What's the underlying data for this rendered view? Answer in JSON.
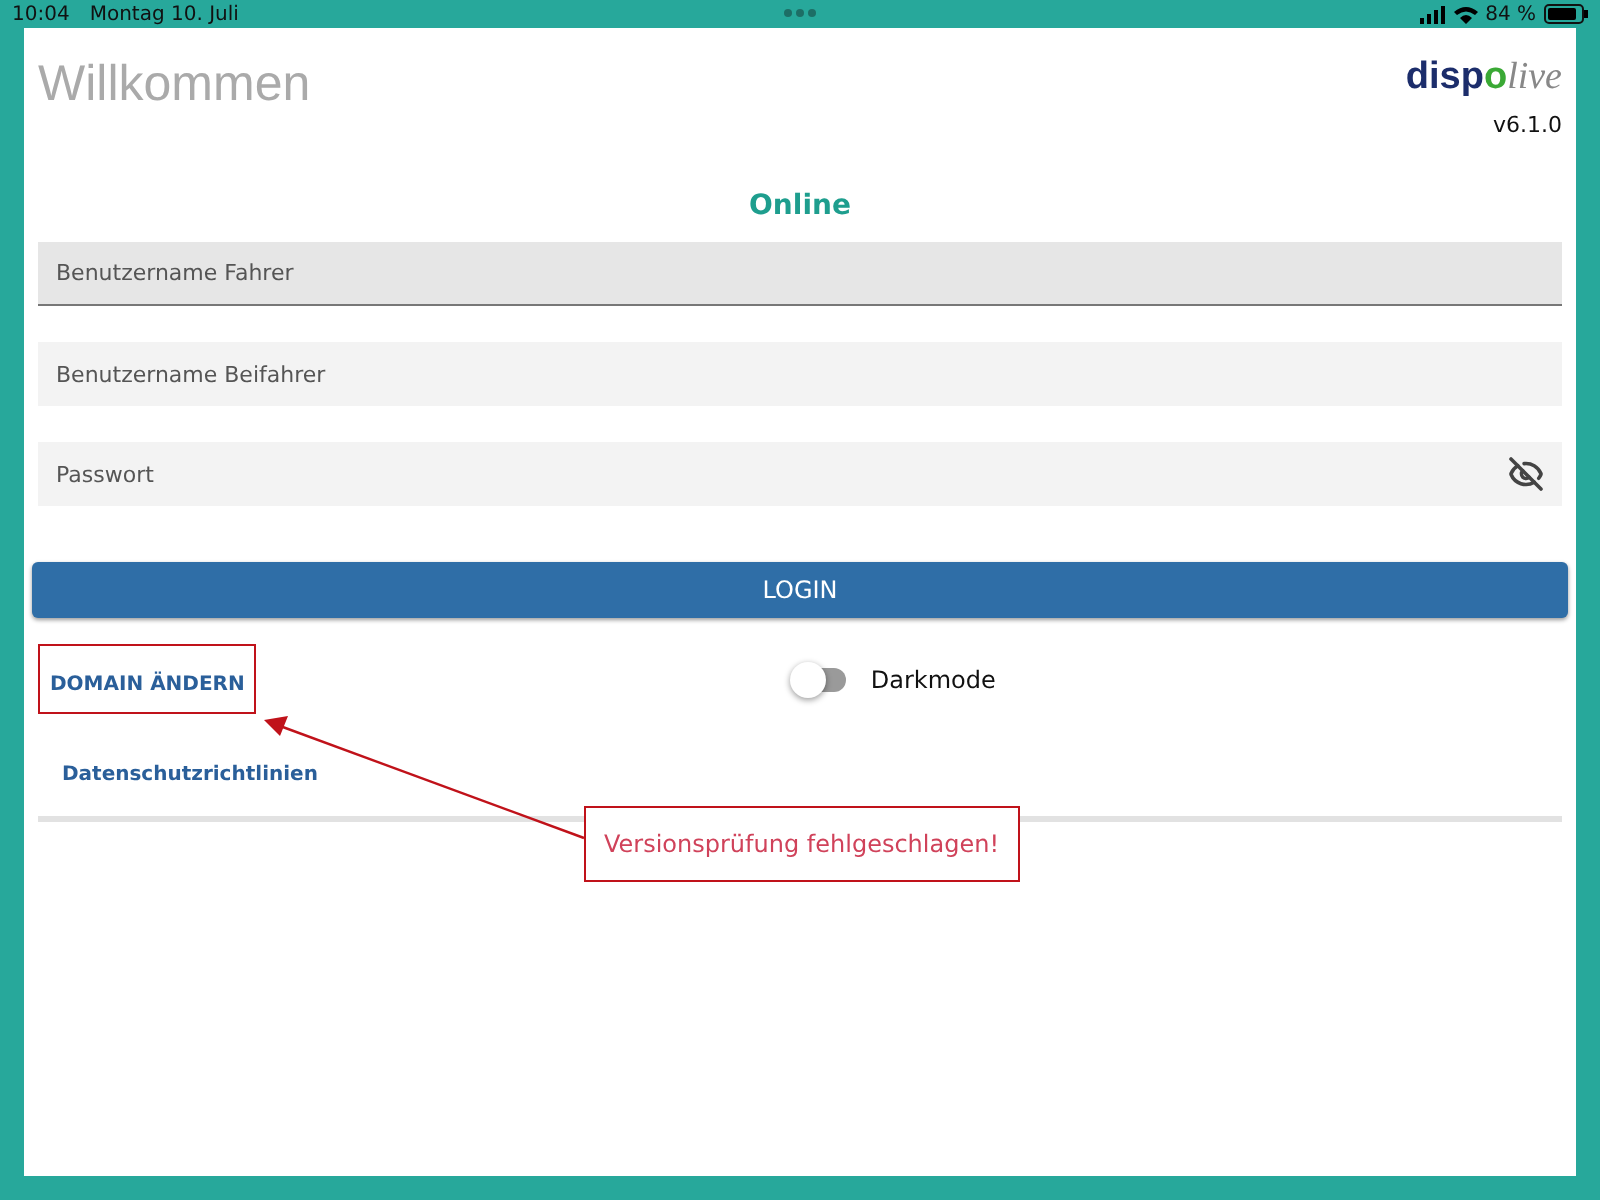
{
  "status_bar": {
    "time": "10:04",
    "date": "Montag 10. Juli",
    "battery": "84 %"
  },
  "header": {
    "title": "Willkommen",
    "logo": {
      "part_1": "disp",
      "part_2": "o",
      "part_3": "live"
    },
    "version": "v6.1.0"
  },
  "connection_status": "Online",
  "fields": [
    {
      "placeholder": "Benutzername Fahrer",
      "focused": true,
      "kind": "text"
    },
    {
      "placeholder": "Benutzername Beifahrer",
      "focused": false,
      "kind": "text"
    },
    {
      "placeholder": "Passwort",
      "focused": false,
      "kind": "password"
    }
  ],
  "login_button": "LOGIN",
  "domain_link": "DOMAIN ÄNDERN",
  "darkmode": {
    "label": "Darkmode",
    "on": false
  },
  "privacy_link": "Datenschutzrichtlinien",
  "annotation": {
    "text": "Versionsprüfung fehlgeschlagen!"
  }
}
